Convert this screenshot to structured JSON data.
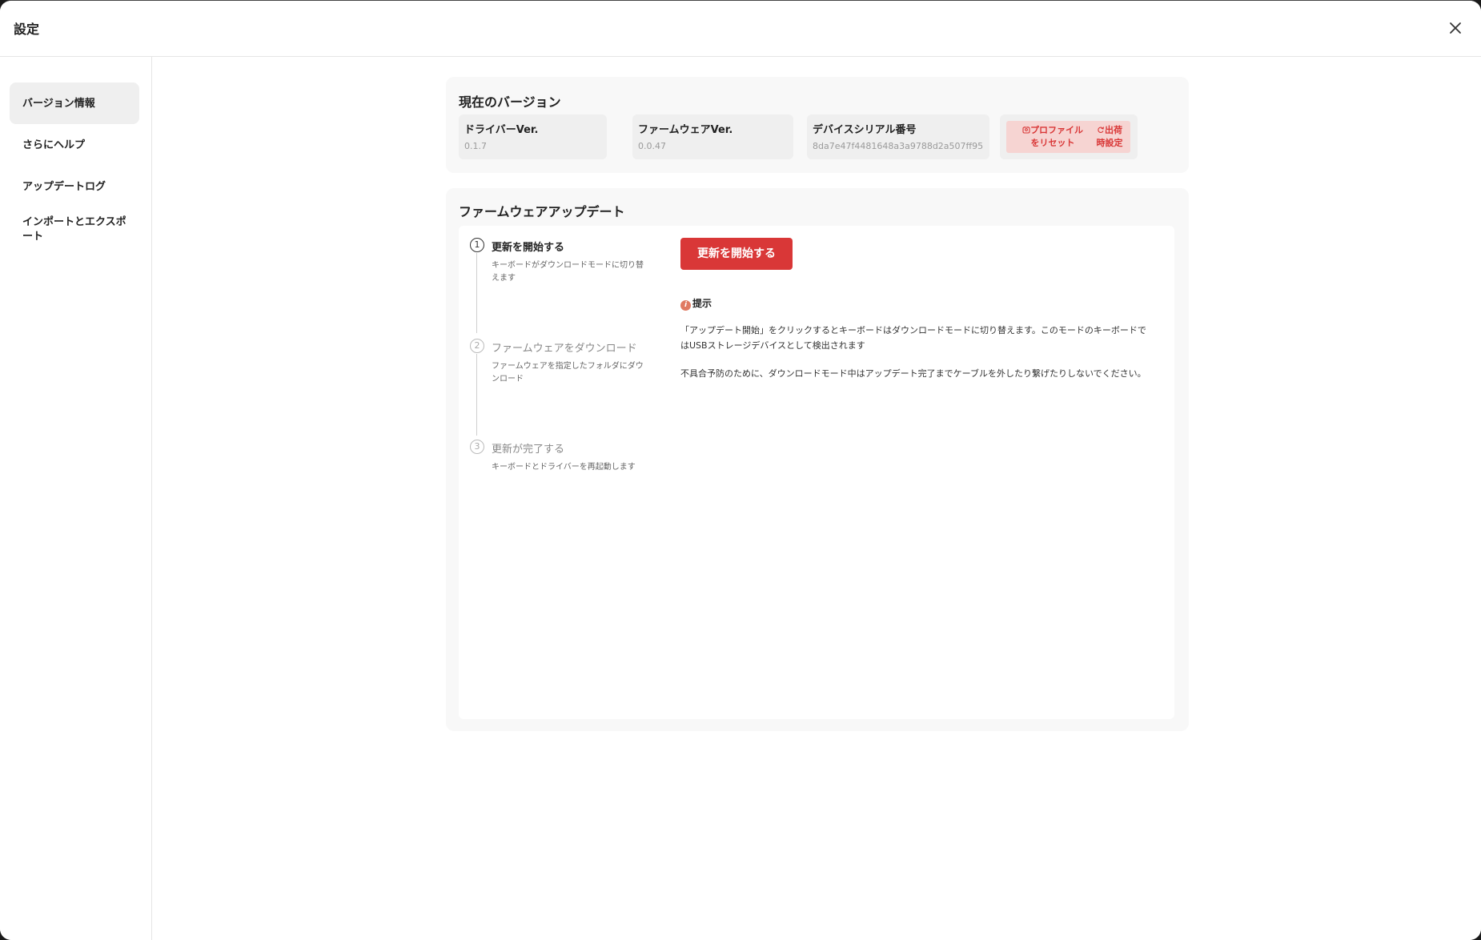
{
  "window": {
    "title": "設定"
  },
  "sidebar": {
    "items": [
      {
        "label": "バージョン情報",
        "active": true
      },
      {
        "label": "さらにヘルプ",
        "active": false
      },
      {
        "label": "アップデートログ",
        "active": false
      },
      {
        "label": "インポートとエクスポート",
        "active": false
      }
    ]
  },
  "version": {
    "title": "現在のバージョン",
    "driver": {
      "label": "ドライバーVer.",
      "value": "0.1.7"
    },
    "firmware": {
      "label": "ファームウェアVer.",
      "value": "0.0.47"
    },
    "serial": {
      "label": "デバイスシリアル番号",
      "value": "8da7e47f4481648a3a9788d2a507ff95"
    },
    "reset_profile_line1": "プロファイル",
    "reset_profile_line2": "をリセット",
    "factory_line1": "出荷",
    "factory_line2": "時設定"
  },
  "update": {
    "title": "ファームウェアアップデート",
    "steps": [
      {
        "num": "1",
        "title": "更新を開始する",
        "desc": "キーボードがダウンロードモードに切り替えます",
        "active": true
      },
      {
        "num": "2",
        "title": "ファームウェアをダウンロード",
        "desc": "ファームウェアを指定したフォルダにダウンロード",
        "active": false
      },
      {
        "num": "3",
        "title": "更新が完了する",
        "desc": "キーボードとドライバーを再起動します",
        "active": false
      }
    ],
    "start_button": "更新を開始する",
    "tip_title": "提示",
    "tip_icon": "i",
    "tip_text1": "「アップデート開始」をクリックするとキーボードはダウンロードモードに切り替えます。このモードのキーボードではUSBストレージデバイスとして検出されます",
    "tip_text2": "不具合予防のために、ダウンロードモード中はアップデート完了までケーブルを外したり繋げたりしないでください。"
  },
  "colors": {
    "accent": "#d93737",
    "accent_light": "#f6d4d2",
    "card_bg": "#f8f8f8"
  }
}
